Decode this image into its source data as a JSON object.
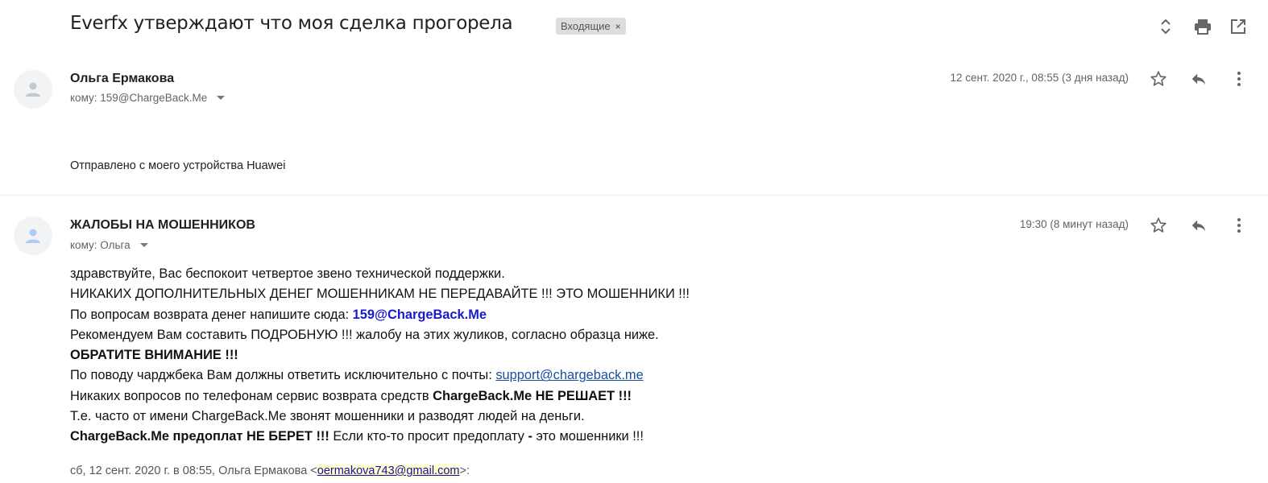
{
  "thread": {
    "subject": "Everfx утверждают что моя сделка прогорела",
    "label": "Входящие",
    "label_remove": "×",
    "icons": [
      "expand-collapse-icon",
      "print-icon",
      "open-new-window-icon"
    ]
  },
  "messages": [
    {
      "sender": "Ольга Ермакова",
      "to": "кому: 159@ChargeBack.Me",
      "date": "12 сент. 2020 г., 08:55 (3 дня назад)",
      "body": "Отправлено с моего устройства Huawei"
    },
    {
      "sender": "ЖАЛОБЫ НА МОШЕННИКОВ",
      "to": "кому: Ольга",
      "date": "19:30 (8 минут назад)",
      "lines": {
        "l1": "здравствуйте, Вас беспокоит четвертое звено технической поддержки.",
        "l2": "НИКАКИХ ДОПОЛНИТЕЛЬНЫХ ДЕНЕГ МОШЕННИКАМ НЕ ПЕРЕДАВАЙТЕ !!! ЭТО МОШЕННИКИ !!!",
        "l3_text": "По вопросам возврата денег напишите сюда: ",
        "l3_email": "159@ChargeBack.Me",
        "l4": "Рекомендуем Вам составить ПОДРОБНУЮ !!! жалобу на этих жуликов, согласно образца ниже.",
        "l5": "ОБРАТИТЕ ВНИМАНИЕ !!!",
        "l6_text": "По поводу чарджбека Вам должны ответить исключительно с почты: ",
        "l6_link": "support@chargeback.me",
        "l7_text": "Никаких вопросов по телефонам сервис возврата средств ",
        "l7_bold": "ChargeBack.Me НЕ РЕШАЕТ !!!",
        "l8": "Т.е. часто от имени ChargeBack.Me звонят мошенники и разводят людей на деньги.",
        "l9_bold": "ChargeBack.Me предоплат НЕ БЕРЕТ !!!",
        "l9_text": " Если кто-то просит предоплату ",
        "l9_dash": "-",
        "l9_end": " это мошенники !!!"
      },
      "quote": {
        "prefix": "сб, 12 сент. 2020 г. в 08:55, Ольга Ермакова <",
        "email": "oermakova743@gmail.com",
        "suffix": ">:"
      }
    }
  ]
}
